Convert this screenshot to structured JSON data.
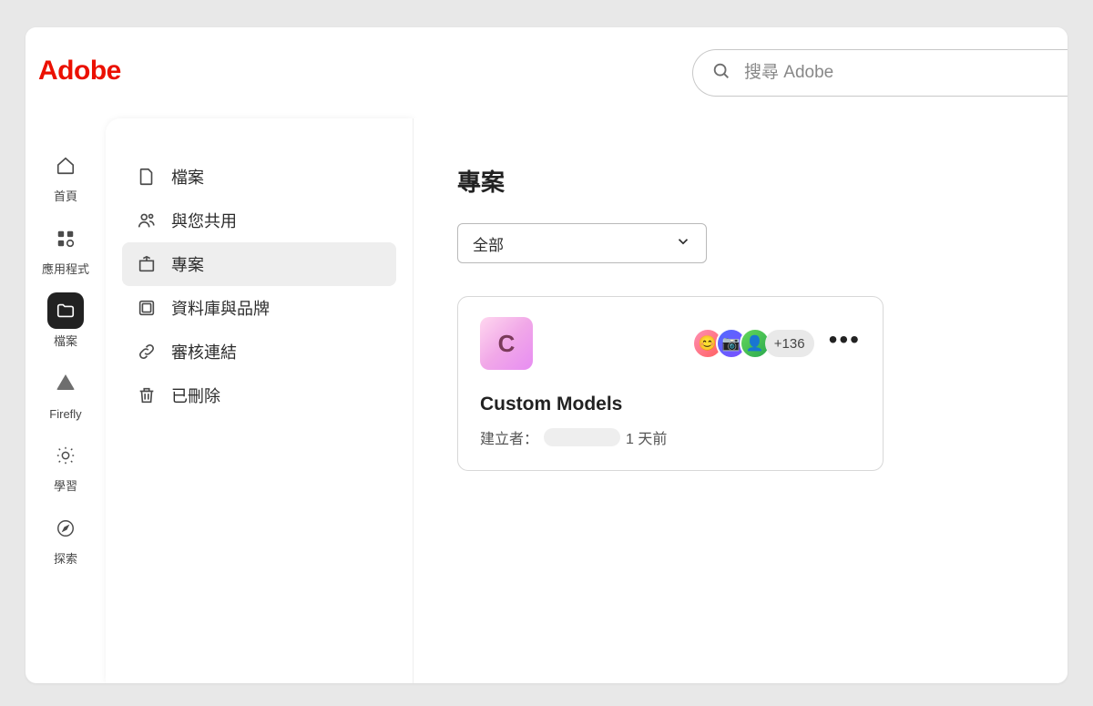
{
  "brand": "Adobe",
  "colors": {
    "brand_red": "#eb1000"
  },
  "search": {
    "placeholder": "搜尋 Adobe"
  },
  "rail": {
    "home": "首頁",
    "apps": "應用程式",
    "files": "檔案",
    "firefly": "Firefly",
    "learn": "學習",
    "explore": "探索"
  },
  "sidebar": {
    "files": "檔案",
    "shared": "與您共用",
    "projects": "專案",
    "libraries": "資料庫與品牌",
    "review": "審核連結",
    "deleted": "已刪除"
  },
  "main": {
    "title": "專案",
    "filter_value": "全部"
  },
  "project_card": {
    "thumb_letter": "C",
    "title": "Custom Models",
    "creator_label": "建立者：",
    "timestamp": "1 天前",
    "more_count": "+136"
  }
}
